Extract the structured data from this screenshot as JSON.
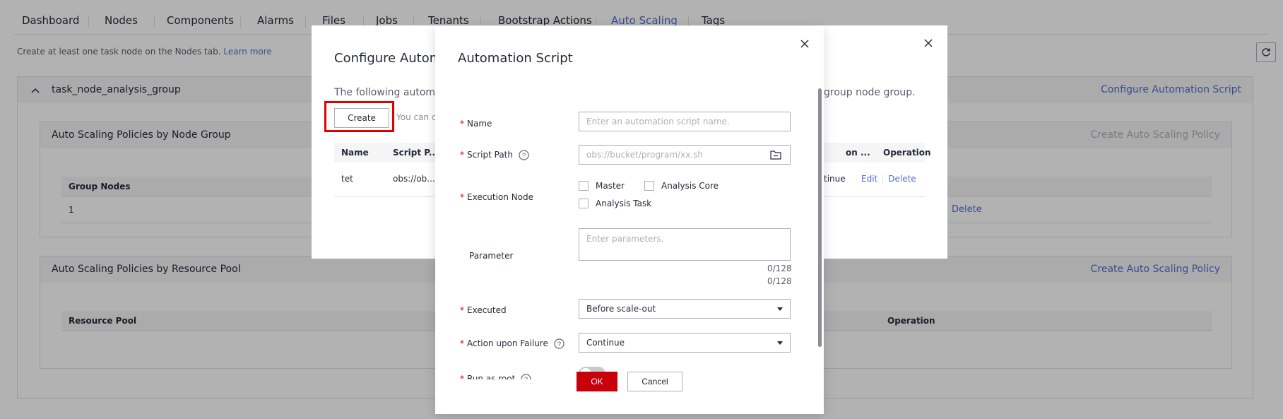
{
  "tabs": [
    {
      "label": "Dashboard",
      "active": false
    },
    {
      "label": "Nodes",
      "active": false
    },
    {
      "label": "Components",
      "active": false
    },
    {
      "label": "Alarms",
      "active": false
    },
    {
      "label": "Files",
      "active": false
    },
    {
      "label": "Jobs",
      "active": false
    },
    {
      "label": "Tenants",
      "active": false
    },
    {
      "label": "Bootstrap Actions",
      "active": false
    },
    {
      "label": "Auto Scaling",
      "active": true
    },
    {
      "label": "Tags",
      "active": false
    }
  ],
  "hint": {
    "text": "Create at least one task node on the Nodes tab.",
    "link": "Learn more"
  },
  "node_group_panel": {
    "title": "task_node_analysis_group",
    "configure_link": "Configure Automation Script"
  },
  "node_group_policies": {
    "title": "Auto Scaling Policies by Node Group",
    "create_link": "Create Auto Scaling Policy",
    "columns": [
      "Group Nodes"
    ],
    "rows": [
      {
        "group_nodes": "1",
        "action": "Delete"
      }
    ]
  },
  "resource_pool_policies": {
    "title": "Auto Scaling Policies by Resource Pool",
    "create_link": "Create Auto Scaling Policy",
    "columns": [
      "Resource Pool",
      "Operation"
    ]
  },
  "configure_dialog": {
    "title": "Configure Automa",
    "desc_left": "The following automat",
    "desc_right": "group node group.",
    "create_button": "Create",
    "note": "You can c",
    "columns": [
      "Name",
      "Script P...",
      "on ...",
      "Operation"
    ],
    "rows": [
      {
        "name": "tet",
        "script_path": "obs://ob...",
        "action_upon_failure": "tinue",
        "edit": "Edit",
        "delete": "Delete"
      }
    ]
  },
  "automation_dialog": {
    "title": "Automation Script",
    "name": {
      "label": "Name",
      "placeholder": "Enter an automation script name."
    },
    "script_path": {
      "label": "Script Path",
      "placeholder": "obs://bucket/program/xx.sh"
    },
    "execution_node": {
      "label": "Execution Node",
      "options": [
        "Master",
        "Analysis Core",
        "Analysis Task"
      ]
    },
    "parameter": {
      "label": "Parameter",
      "placeholder": "Enter parameters.",
      "counter1": "0/128",
      "counter2": "0/128"
    },
    "executed": {
      "label": "Executed",
      "value": "Before scale-out"
    },
    "action_upon_failure": {
      "label": "Action upon Failure",
      "value": "Continue"
    },
    "run_as_root": {
      "label": "Run as root",
      "enabled": false
    },
    "ok_button": "OK",
    "cancel_button": "Cancel"
  },
  "colors": {
    "accent": "#526ecc",
    "primary_button": "#c7000b",
    "required": "#e00000",
    "highlight": "#e00000"
  }
}
